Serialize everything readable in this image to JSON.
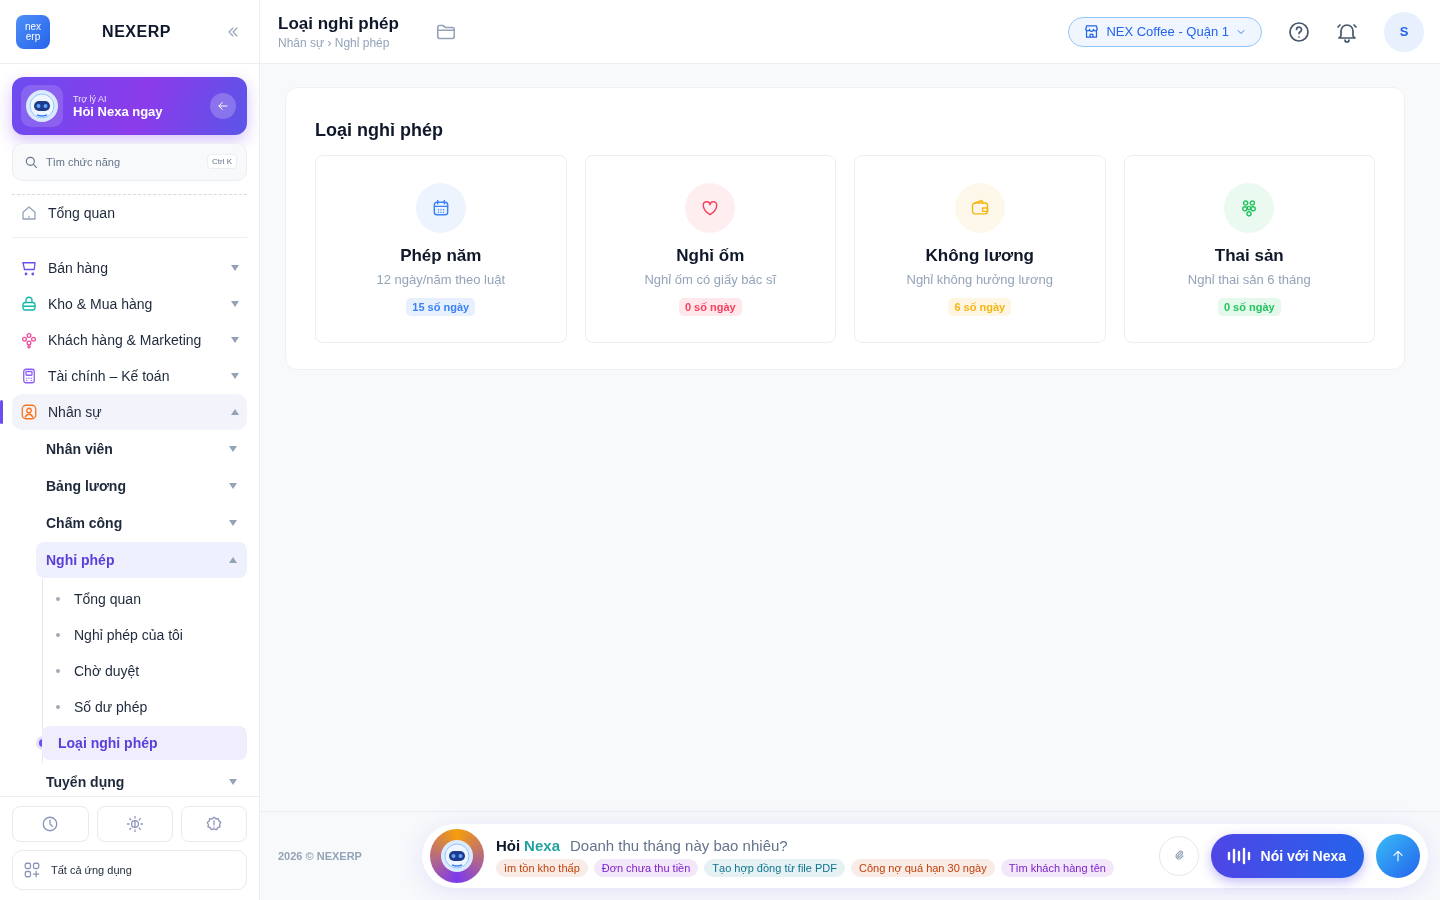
{
  "brand": {
    "name": "NEXERP",
    "logo_text": "nex erp"
  },
  "assistant_card": {
    "caption": "Trợ lý AI",
    "title": "Hỏi Nexa ngay"
  },
  "search": {
    "placeholder": "Tìm chức năng",
    "shortcut": "Ctrl K"
  },
  "nav": [
    {
      "label": "Tổng quan",
      "selected": false
    },
    {
      "label": "Bán hàng",
      "selected": false,
      "expanded": false
    },
    {
      "label": "Kho & Mua hàng",
      "selected": false,
      "expanded": false
    },
    {
      "label": "Khách hàng & Marketing",
      "selected": false,
      "expanded": false
    },
    {
      "label": "Tài chính – Kế toán",
      "selected": false,
      "expanded": false
    },
    {
      "label": "Nhân sự",
      "selected": true,
      "expanded": true,
      "children": [
        {
          "label": "Nhân viên",
          "selected": false,
          "expanded": false
        },
        {
          "label": "Bảng lương",
          "selected": false,
          "expanded": false
        },
        {
          "label": "Chấm công",
          "selected": false,
          "expanded": false
        },
        {
          "label": "Nghỉ phép",
          "selected": true,
          "expanded": true,
          "children": [
            {
              "label": "Tổng quan",
              "selected": false
            },
            {
              "label": "Nghỉ phép của tôi",
              "selected": false
            },
            {
              "label": "Chờ duyệt",
              "selected": false
            },
            {
              "label": "Số dư phép",
              "selected": false
            },
            {
              "label": "Loại nghỉ phép",
              "selected": true
            }
          ]
        },
        {
          "label": "Tuyển dụng",
          "selected": false,
          "expanded": false
        }
      ]
    }
  ],
  "sidebar_footer": {
    "all_apps": "Tất cả ứng dụng"
  },
  "header": {
    "title": "Loại nghỉ phép",
    "breadcrumb": "Nhân sự › Nghỉ phép",
    "store": "NEX Coffee - Quận 1",
    "avatar": "S"
  },
  "panel": {
    "title": "Loại nghỉ phép",
    "cards": [
      {
        "kind": "calendar",
        "color": "#3b82f6",
        "title": "Phép năm",
        "description": "12 ngày/năm theo luật",
        "badge": "15 số ngày"
      },
      {
        "kind": "heart",
        "color": "#f43f5e",
        "title": "Nghỉ ốm",
        "description": "Nghỉ ốm có giấy bác sĩ",
        "badge": "0 số ngày"
      },
      {
        "kind": "wallet",
        "color": "#f5b615",
        "title": "Không lương",
        "description": "Nghỉ không hưởng lương",
        "badge": "6 số ngày"
      },
      {
        "kind": "family",
        "color": "#22c55e",
        "title": "Thai sản",
        "description": "Nghỉ thai sản 6 tháng",
        "badge": "0 số ngày"
      }
    ]
  },
  "footer": {
    "copyright": "2026 © NEXERP"
  },
  "ask_bar": {
    "label": "Hỏi",
    "name": "Nexa",
    "placeholder": "Doanh thu tháng này bao nhiêu?",
    "voice_button": "Nói với Nexa",
    "suggestions": [
      {
        "text": "ìm tồn kho thấp",
        "color": "#c2410c"
      },
      {
        "text": "Đơn chưa thu tiền",
        "color": "#7e22ce"
      },
      {
        "text": "Tạo hợp đồng từ file PDF",
        "color": "#0e7490"
      },
      {
        "text": "Công nợ quá hạn 30 ngày",
        "color": "#c2410c"
      },
      {
        "text": "Tìm khách hàng tên",
        "color": "#7e22ce"
      }
    ]
  }
}
